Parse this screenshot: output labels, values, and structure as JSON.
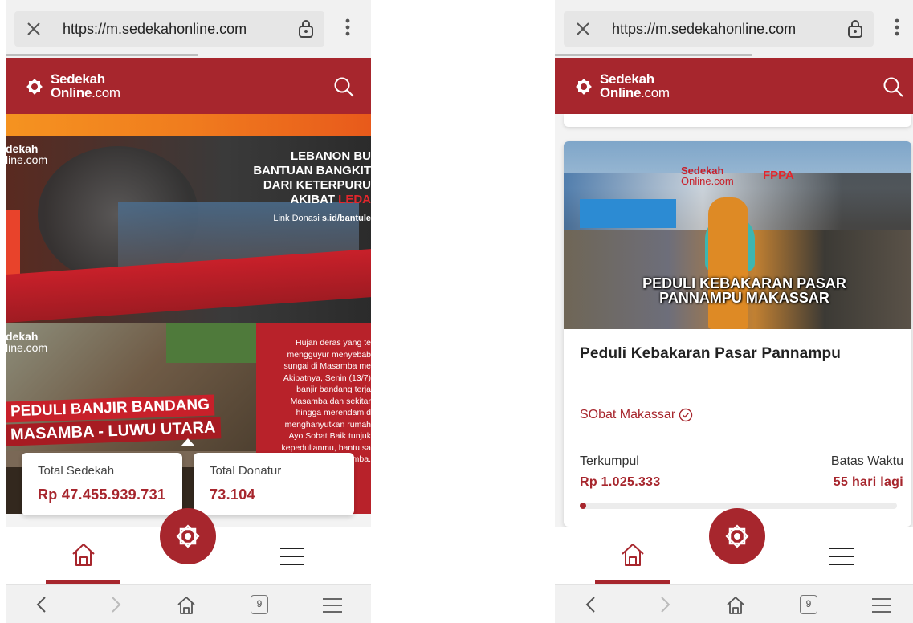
{
  "browser": {
    "url": "https://m.sedekahonline.com",
    "tab_count": "9"
  },
  "brand": {
    "line1": "Sedekah",
    "line2_bold": "Online",
    "line2_light": ".com",
    "primary_color": "#a7262d"
  },
  "left_screen": {
    "hero1": {
      "brand_top": "dekah",
      "brand_bottom": "line.com",
      "title": "LEBANON BU\nBANTUAN BANGKIT\nDARI KETERPURU\nAKIBAT",
      "title_red": "LEDA",
      "link_label": "Link Donasi",
      "link_url": "s.id/bantule"
    },
    "hero2": {
      "brand_top": "dekah",
      "brand_bottom": "line.com",
      "banner_line1": "PEDULI BANJIR BANDANG",
      "banner_line2": "MASAMBA - LUWU UTARA",
      "panel_text": "Hujan deras yang te\nmengguyur menyebab\nsungai di Masamba me\nAkibatnya, Senin (13/7)\nbanjir bandang terja\nMasamba dan sekitar\nhingga merendam d\nmenghanyutkan rumah\nAyo Sobat Baik tunjuk\nkepedulianmu, bantu sa\nkita di Masamba."
    },
    "stats": {
      "total_sedekah_label": "Total Sedekah",
      "total_sedekah_value": "Rp 47.455.939.731",
      "total_donatur_label": "Total Donatur",
      "total_donatur_value": "73.104"
    }
  },
  "right_screen": {
    "campaign": {
      "image_logo_a_top": "Sedekah",
      "image_logo_a_bottom": "Online.com",
      "image_logo_b": "FPPA",
      "image_overlay": "PEDULI KEBAKARAN PASAR\nPANNAMPU MAKASSAR",
      "title": "Peduli Kebakaran Pasar Pannampu",
      "organizer": "SObat Makassar",
      "collected_label": "Terkumpul",
      "collected_value": "Rp 1.025.333",
      "deadline_label": "Batas Waktu",
      "deadline_value": "55 hari lagi",
      "progress": 0.02
    }
  },
  "icons": {
    "close": "close-icon",
    "lock": "lock-icon",
    "overflow": "more-vertical-icon",
    "search": "search-icon",
    "home": "home-icon",
    "menu": "hamburger-menu-icon",
    "fab": "sedekah-logo-icon",
    "back": "chevron-left-icon",
    "forward": "chevron-right-icon",
    "tabs": "tabs-icon",
    "verified": "verified-check-icon"
  }
}
